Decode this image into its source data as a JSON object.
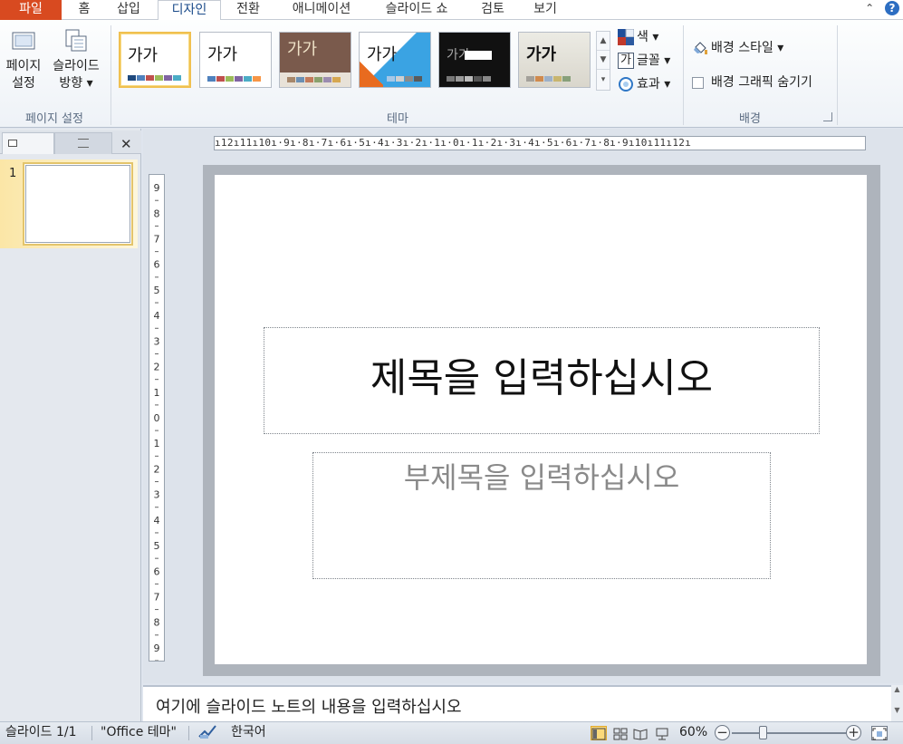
{
  "tabs": [
    {
      "label": "파일"
    },
    {
      "label": "홈"
    },
    {
      "label": "삽입"
    },
    {
      "label": "디자인"
    },
    {
      "label": "전환"
    },
    {
      "label": "애니메이션"
    },
    {
      "label": "슬라이드 쇼"
    },
    {
      "label": "검토"
    },
    {
      "label": "보기"
    }
  ],
  "active_tab": "디자인",
  "help_label": "?",
  "ribbon": {
    "page_setup": {
      "page_setup_line1": "페이지",
      "page_setup_line2": "설정",
      "orientation_line1": "슬라이드",
      "orientation_line2": "방향 ▾",
      "group_label": "페이지 설정"
    },
    "themes": {
      "group_label": "테마",
      "items": [
        {
          "label": "가가"
        },
        {
          "label": "가가"
        },
        {
          "label": "가가"
        },
        {
          "label": "가가"
        },
        {
          "label": "가가"
        },
        {
          "label": "가가"
        }
      ],
      "colors_label": "색 ▾",
      "fonts_label": "글꼴 ▾",
      "effects_label": "효과 ▾",
      "fonts_icon_text": "가"
    },
    "background": {
      "group_label": "배경",
      "styles_label": "배경 스타일 ▾",
      "hide_graphics_label": "배경 그래픽 숨기기",
      "hide_graphics_checked": false
    }
  },
  "slides_panel": {
    "thumbnails": [
      {
        "number": "1"
      }
    ]
  },
  "ruler": {
    "horizontal": "ı12ı11ı10ı·9ı·8ı·7ı·6ı·5ı·4ı·3ı·2ı·1ı·0ı·1ı·2ı·3ı·4ı·5ı·6ı·7ı·8ı·9ı10ı11ı12ı",
    "vertical": [
      "9",
      "8",
      "7",
      "6",
      "5",
      "4",
      "3",
      "2",
      "1",
      "0",
      "1",
      "2",
      "3",
      "4",
      "5",
      "6",
      "7",
      "8",
      "9"
    ]
  },
  "slide": {
    "title_placeholder": "제목을 입력하십시오",
    "subtitle_placeholder": "부제목을 입력하십시오"
  },
  "notes": {
    "placeholder": "여기에 슬라이드 노트의 내용을 입력하십시오"
  },
  "status": {
    "slide_counter": "슬라이드 1/1",
    "theme_name": "\"Office 테마\"",
    "language": "한국어",
    "zoom": "60%",
    "zoom_percent": 60
  }
}
